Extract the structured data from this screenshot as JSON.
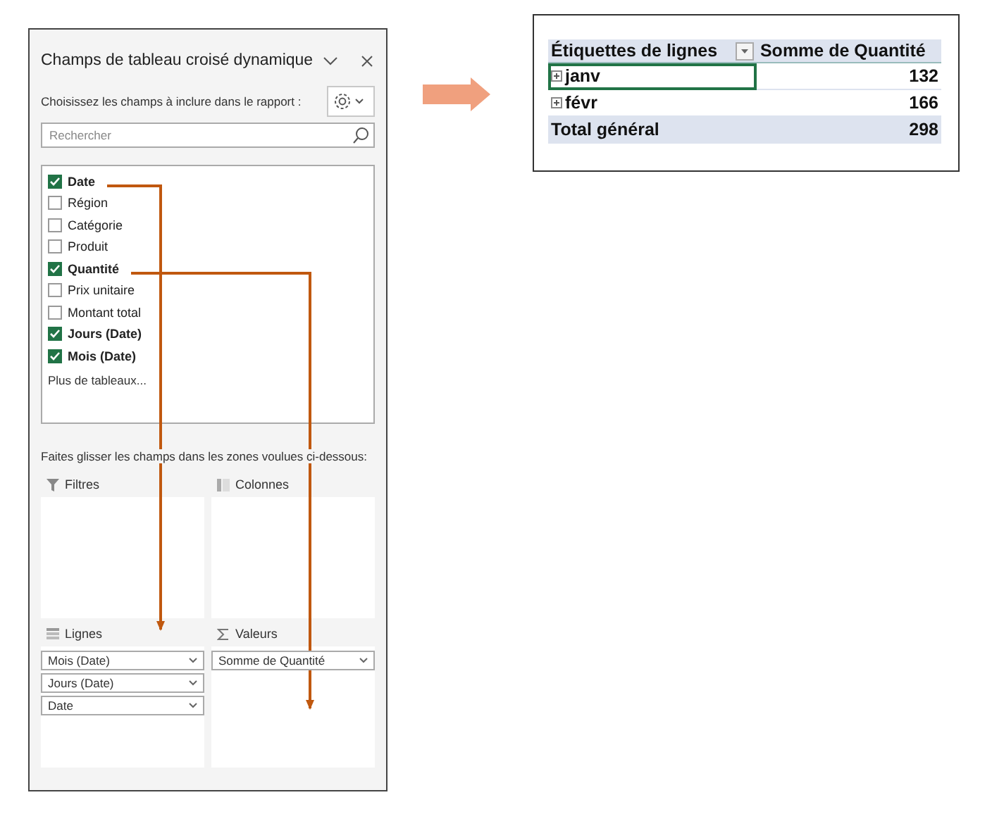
{
  "panel": {
    "title": "Champs de tableau croisé dynamique",
    "subtitle": "Choisissez les champs à inclure dans le rapport :",
    "search": {
      "placeholder": "Rechercher"
    },
    "fields": [
      {
        "label": "Date",
        "checked": true
      },
      {
        "label": "Région",
        "checked": false
      },
      {
        "label": "Catégorie",
        "checked": false
      },
      {
        "label": "Produit",
        "checked": false
      },
      {
        "label": "Quantité",
        "checked": true
      },
      {
        "label": "Prix unitaire",
        "checked": false
      },
      {
        "label": "Montant total",
        "checked": false
      },
      {
        "label": "Jours (Date)",
        "checked": true
      },
      {
        "label": "Mois (Date)",
        "checked": true
      }
    ],
    "more_tables": "Plus de tableaux...",
    "drag_hint": "Faites glisser les champs dans les zones voulues ci-dessous:",
    "areas": [
      {
        "kind": "filter",
        "title": "Filtres"
      },
      {
        "kind": "columns",
        "title": "Colonnes"
      },
      {
        "kind": "rows",
        "title": "Lignes",
        "items": [
          "Mois (Date)",
          "Jours (Date)",
          "Date"
        ]
      },
      {
        "kind": "values",
        "title": "Valeurs",
        "items": [
          "Somme de Quantité"
        ]
      }
    ]
  },
  "pivot": {
    "columns": [
      "Étiquettes de lignes",
      "Somme de Quantité"
    ],
    "rows": [
      {
        "label": "janv",
        "value": "132",
        "selected": true
      },
      {
        "label": "févr",
        "value": "166",
        "selected": false
      }
    ],
    "total": {
      "label": "Total général",
      "value": "298"
    }
  }
}
